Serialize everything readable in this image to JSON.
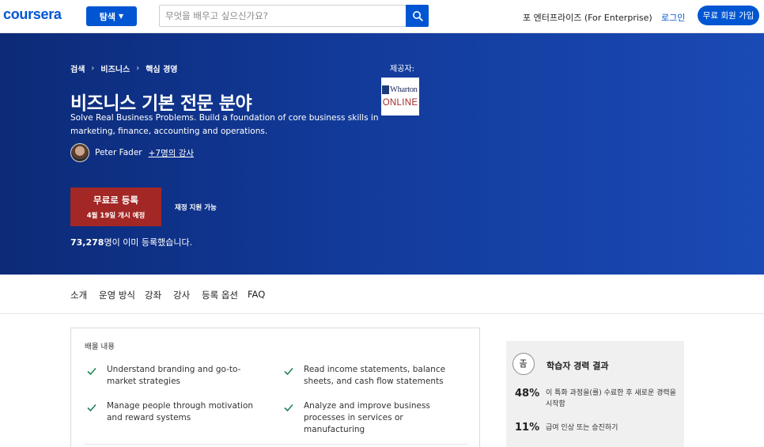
{
  "header": {
    "logo": "coursera",
    "explore_label": "탐색",
    "search_placeholder": "무엇을 배우고 싶으신가요?",
    "enterprise_label": "포 엔터프라이즈 (For Enterprise)",
    "login_label": "로그인",
    "signup_label": "무료 회원 가입"
  },
  "hero": {
    "breadcrumb": [
      "검색",
      "비즈니스",
      "핵심 경영"
    ],
    "title": "비즈니스 기본 전문 분야",
    "description": "Solve Real Business Problems. Build a foundation of core business skills in marketing, finance, accounting and operations.",
    "instructor_name": "Peter Fader",
    "instructor_more": "+7명의 강사",
    "provider_label": "제공자:",
    "provider_logo_top": "Wharton",
    "provider_logo_bottom": "ONLINE",
    "enroll_main": "무료로 등록",
    "enroll_sub": "4월 19일 개시 예정",
    "financial_aid": "재정 지원 가능",
    "enrolled_count": "73,278",
    "enrolled_suffix": "명이 이미 등록했습니다."
  },
  "tabs": [
    "소개",
    "운영 방식",
    "강좌",
    "강사",
    "등록 옵션",
    "FAQ"
  ],
  "learn": {
    "title": "배울 내용",
    "items": [
      "Understand branding and go-to-market strategies",
      "Read income statements, balance sheets, and cash flow statements",
      "Manage people through motivation and reward systems",
      "Analyze and improve business processes in services or manufacturing"
    ]
  },
  "outcomes": {
    "title": "학습자 경력 결과",
    "stats": [
      {
        "value": "48%",
        "label": "이 특화 과정을(를) 수료한 후 새로운 경력을 시작함"
      },
      {
        "value": "11%",
        "label": "급여 인상 또는 승진하기"
      }
    ]
  },
  "colors": {
    "brand_blue": "#0056d2",
    "hero_dark": "#0c2a77",
    "enroll_red": "#a22725",
    "check_green": "#1f8354"
  }
}
